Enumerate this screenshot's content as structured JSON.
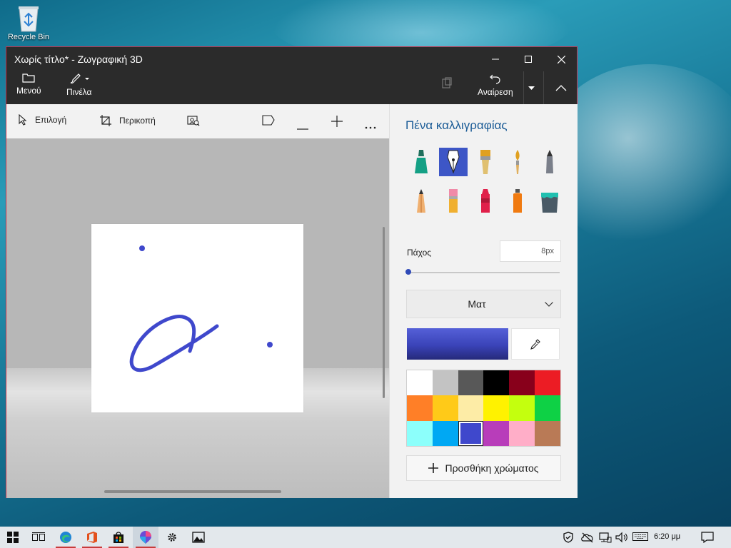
{
  "desktop": {
    "recycle_bin_label": "Recycle Bin"
  },
  "window": {
    "title": "Χωρίς τίτλο* - Ζωγραφική 3D",
    "menu_label": "Μενού",
    "brushes_label": "Πινέλα",
    "undo_label": "Αναίρεση"
  },
  "toolbar": {
    "select_label": "Επιλογή",
    "crop_label": "Περικοπή"
  },
  "panel": {
    "title": "Πένα καλλιγραφίας",
    "brushes": [
      "marker",
      "calligraphy-pen",
      "oil-brush",
      "watercolor",
      "pixel-pen",
      "pencil",
      "eraser",
      "crayon",
      "spray-can",
      "fill-bucket"
    ],
    "selected_brush": "calligraphy-pen",
    "thickness_label": "Πάχος",
    "thickness_value": "8px",
    "thickness_fraction": 0.0,
    "finish_value": "Ματ",
    "current_color": "#3f48cc",
    "palette": [
      "#ffffff",
      "#c3c3c3",
      "#585858",
      "#000000",
      "#88001b",
      "#ec1c24",
      "#ff7f27",
      "#ffca18",
      "#fdeca6",
      "#fff200",
      "#c4ff0e",
      "#0ed145",
      "#8cfffb",
      "#00a8f3",
      "#3f48cc",
      "#b83dba",
      "#ffaec8",
      "#b97a56"
    ],
    "selected_palette_index": 14,
    "add_color_label": "Προσθήκη χρώματος"
  },
  "taskbar": {
    "apps": [
      "start-icon",
      "task-view-icon",
      "edge-icon",
      "office-icon",
      "store-icon",
      "paint3d-icon",
      "settings-icon",
      "photos-icon"
    ],
    "active_apps": [
      "edge-icon",
      "office-icon",
      "store-icon",
      "paint3d-icon"
    ],
    "clock": "6:20 μμ"
  }
}
